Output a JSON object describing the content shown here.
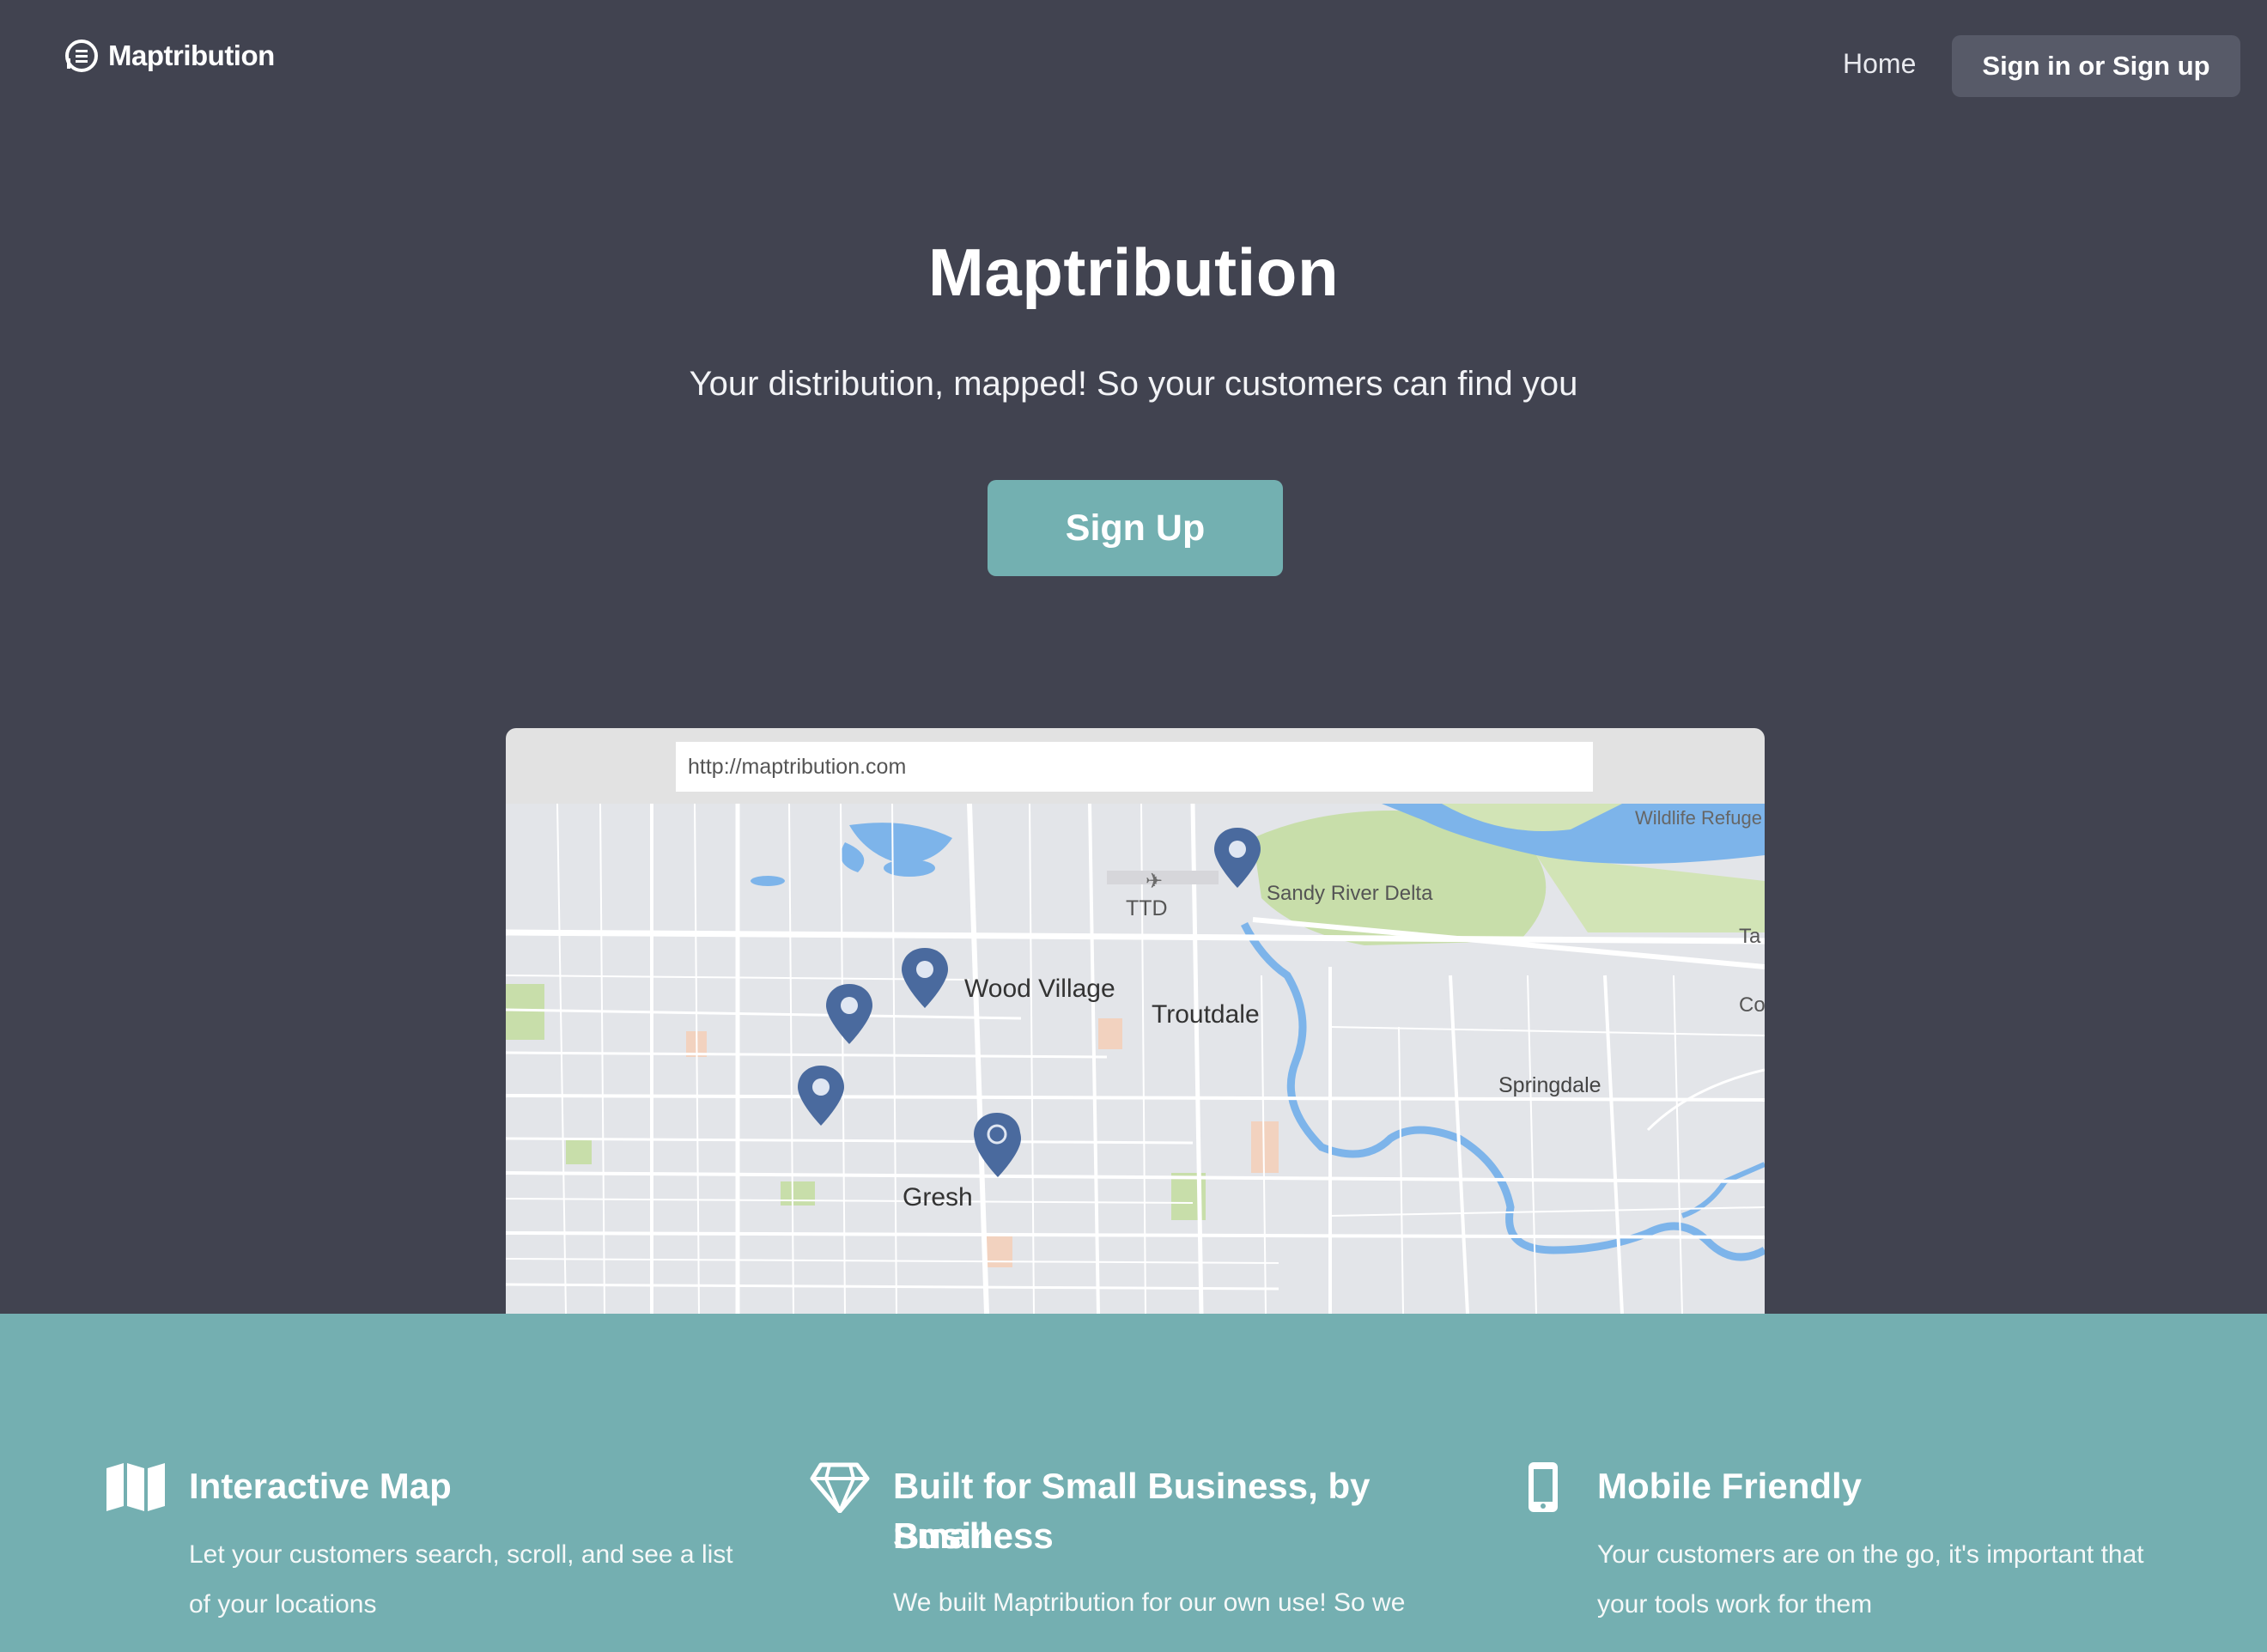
{
  "nav": {
    "brand": "Maptribution",
    "home_label": "Home",
    "signin_label": "Sign in or Sign up"
  },
  "hero": {
    "title": "Maptribution",
    "subtitle": "Your distribution, mapped! So your customers can find you",
    "cta_label": "Sign Up"
  },
  "preview": {
    "url": "http://maptribution.com",
    "map_labels": {
      "wildlife": "Wildlife Refuge",
      "ttd": "TTD",
      "sandy": "Sandy River Delta",
      "wood_village": "Wood Village",
      "troutdale": "Troutdale",
      "springdale": "Springdale",
      "gresham": "Gresh",
      "edge_ta": "Ta",
      "edge_co": "Co"
    }
  },
  "features": [
    {
      "icon": "map-icon",
      "title": "Interactive Map",
      "desc_lines": [
        "Let your customers search, scroll, and see a list",
        "of your locations"
      ]
    },
    {
      "icon": "diamond-icon",
      "title_lines": [
        "Built for Small Business, by Small",
        "Business"
      ],
      "desc_lines": [
        "We built Maptribution for our own use! So we"
      ]
    },
    {
      "icon": "mobile-icon",
      "title": "Mobile Friendly",
      "desc_lines": [
        "Your customers are on the go, it's important that",
        "your tools work for them"
      ]
    }
  ],
  "colors": {
    "background": "#414350",
    "teal": "#74afb1",
    "nav_button": "#575a68",
    "pin": "#4a6a9e",
    "river": "#7db4ea"
  }
}
